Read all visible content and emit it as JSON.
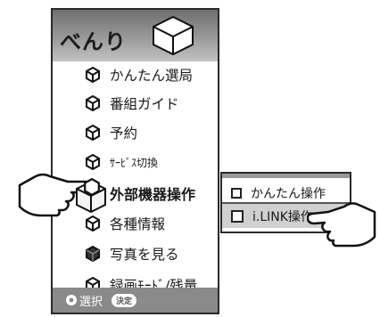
{
  "menu": {
    "title": "べんり",
    "items": [
      {
        "label": "かんたん選局",
        "icon": "cube-outline-icon"
      },
      {
        "label": "番組ガイド",
        "icon": "cube-outline-icon"
      },
      {
        "label": "予約",
        "icon": "cube-outline-icon"
      },
      {
        "label": "ｻｰﾋﾞｽ切換",
        "icon": "cube-outline-icon"
      },
      {
        "label": "外部機器操作",
        "icon": "cube-outline-icon",
        "selected": true
      },
      {
        "label": "各種情報",
        "icon": "cube-outline-icon"
      },
      {
        "label": "写真を見る",
        "icon": "cube-filled-icon"
      },
      {
        "label": "録画ﾓｰﾄﾞ/残量",
        "icon": "cube-outline-icon"
      }
    ],
    "footer": {
      "select_label": "選択",
      "enter_label": "決定"
    }
  },
  "submenu": {
    "items": [
      {
        "label": "かんたん操作"
      },
      {
        "label": "i.LINK操作",
        "selected": true
      }
    ]
  },
  "colors": {
    "header_gradient": "#8a8a8a",
    "footer": "#8a8a8a",
    "selected_bg": "#d0d0d0"
  }
}
